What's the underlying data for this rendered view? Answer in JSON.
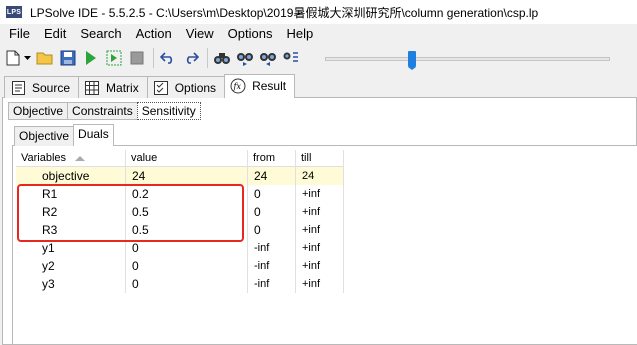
{
  "window": {
    "title": "LPSolve IDE - 5.5.2.5 - C:\\Users\\m\\Desktop\\2019暑假城大深圳研究所\\column generation\\csp.lp",
    "app_icon_text": "LPS"
  },
  "menu": {
    "items": [
      {
        "label": "File"
      },
      {
        "label": "Edit"
      },
      {
        "label": "Search"
      },
      {
        "label": "Action"
      },
      {
        "label": "View"
      },
      {
        "label": "Options"
      },
      {
        "label": "Help"
      }
    ]
  },
  "toolbar": {
    "icons": [
      "new-file-icon",
      "dropdown-arrow-icon",
      "open-folder-icon",
      "save-icon",
      "run-icon",
      "step-icon",
      "stop-icon",
      "undo-icon",
      "redo-icon",
      "find-icon",
      "find-next-icon",
      "find-previous-icon",
      "replace-icon"
    ],
    "slider_position": 0.3
  },
  "main_tabs": [
    {
      "label": "Source",
      "icon": "source-icon"
    },
    {
      "label": "Matrix",
      "icon": "matrix-icon"
    },
    {
      "label": "Options",
      "icon": "options-icon"
    },
    {
      "label": "Result",
      "icon": "result-icon",
      "active": true
    }
  ],
  "result_tabs": [
    {
      "label": "Objective"
    },
    {
      "label": "Constraints"
    },
    {
      "label": "Sensitivity",
      "active": true
    }
  ],
  "sensitivity_tabs": [
    {
      "label": "Objective"
    },
    {
      "label": "Duals",
      "active": true
    }
  ],
  "table": {
    "columns": [
      "Variables",
      "value",
      "from",
      "till"
    ],
    "rows": [
      [
        "objective",
        "24",
        "24",
        "24"
      ],
      [
        "R1",
        "0.2",
        "0",
        "+inf"
      ],
      [
        "R2",
        "0.5",
        "0",
        "+inf"
      ],
      [
        "R3",
        "0.5",
        "0",
        "+inf"
      ],
      [
        "y1",
        "0",
        "-inf",
        "+inf"
      ],
      [
        "y2",
        "0",
        "-inf",
        "+inf"
      ],
      [
        "y3",
        "0",
        "-inf",
        "+inf"
      ]
    ]
  },
  "colors": {
    "highlight_box": "#e8281f",
    "objective_row_bg": "#fefbd6",
    "slider_thumb": "#1f7fe0"
  }
}
